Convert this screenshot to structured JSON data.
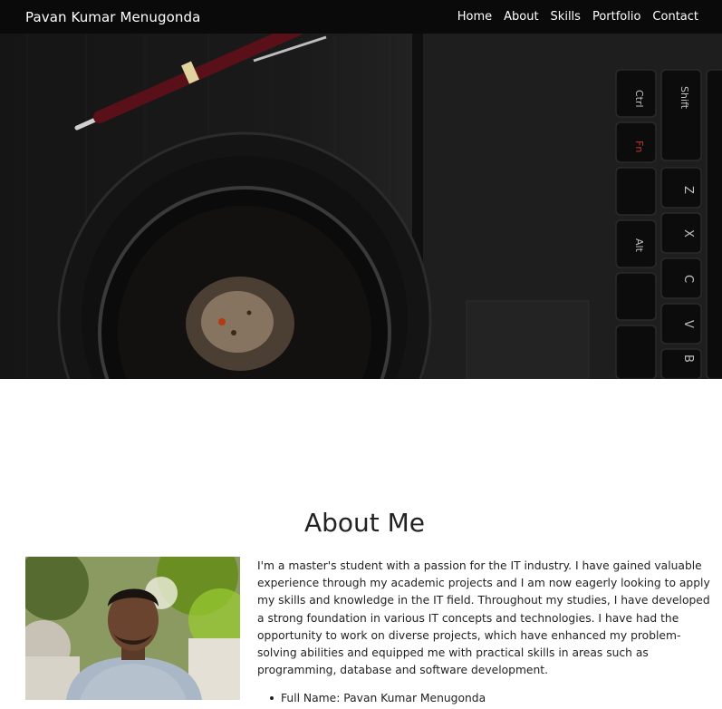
{
  "header": {
    "brand": "Pavan Kumar Menugonda",
    "nav": [
      {
        "label": "Home"
      },
      {
        "label": "About"
      },
      {
        "label": "Skills"
      },
      {
        "label": "Portfolio"
      },
      {
        "label": "Contact"
      }
    ]
  },
  "hero": {
    "keyboard_keys": [
      "Ctrl",
      "Shift",
      "Fn",
      "Z",
      "X",
      "Alt",
      "C",
      "V",
      "B"
    ]
  },
  "about": {
    "title": "About Me",
    "paragraph": "I'm a master's student with a passion for the IT industry. I have gained valuable experience through my academic projects and I am now eagerly looking to apply my skills and knowledge in the IT field. Throughout my studies, I have developed a strong foundation in various IT concepts and technologies. I have had the opportunity to work on diverse projects, which have enhanced my problem-solving abilities and equipped me with practical skills in areas such as programming, database and software development.",
    "facts": [
      {
        "text": "Full Name: Pavan Kumar Menugonda"
      }
    ]
  },
  "colors": {
    "navbar_bg": "#0a0a0a",
    "nav_text": "#ffffff",
    "page_bg": "#ffffff",
    "body_text": "#222222"
  }
}
